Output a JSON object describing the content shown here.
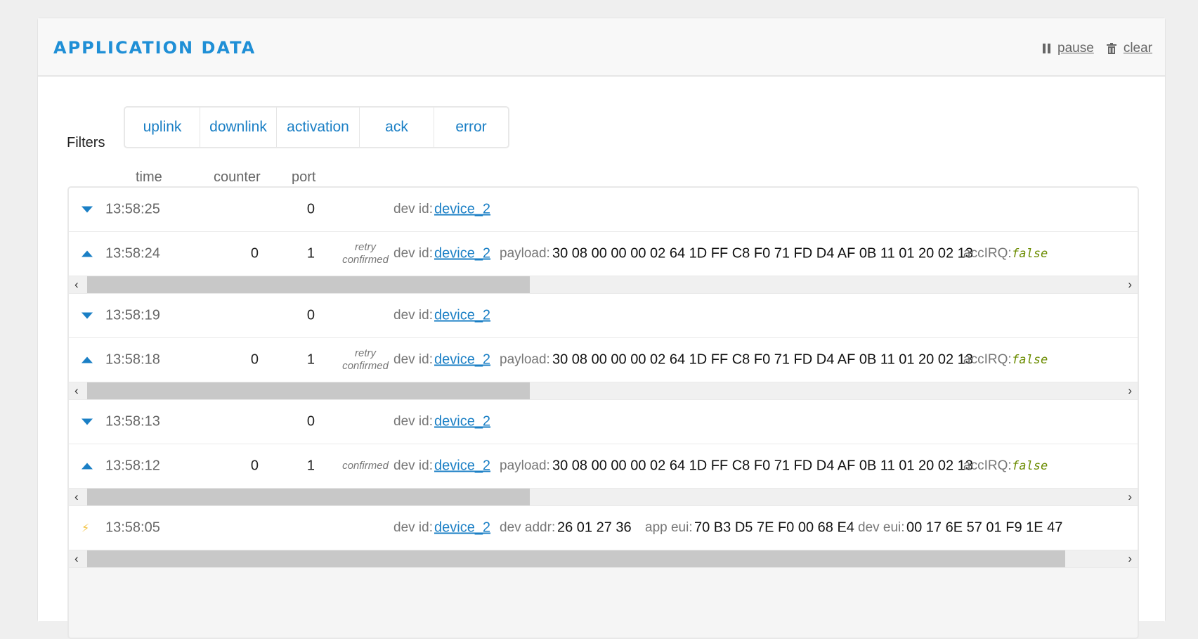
{
  "header": {
    "title": "APPLICATION DATA",
    "pause_label": "pause",
    "clear_label": "clear"
  },
  "filters": {
    "label": "Filters",
    "buttons": [
      "uplink",
      "downlink",
      "activation",
      "ack",
      "error"
    ]
  },
  "columns": {
    "time": "time",
    "counter": "counter",
    "port": "port"
  },
  "labels": {
    "dev_id": "dev id:",
    "payload": "payload:",
    "acc_irq": "accIRQ:",
    "dev_addr": "dev addr:",
    "app_eui": "app eui:",
    "dev_eui": "dev eui:"
  },
  "scroll": {
    "left_arrow": "‹",
    "right_arrow": "›"
  },
  "rows": [
    {
      "type": "downlink",
      "time": "13:58:25",
      "counter": "",
      "port": "0",
      "flag1": "",
      "flag2": "",
      "dev_id": "device_2"
    },
    {
      "type": "uplink",
      "time": "13:58:24",
      "counter": "0",
      "port": "1",
      "flag1": "retry",
      "flag2": "confirmed",
      "dev_id": "device_2",
      "payload": "30 08 00 00 00 02 64 1D FF C8 F0 71 FD D4 AF 0B 11 01 20 02 13",
      "acc_irq": "false",
      "scroll_fraction": 0.43
    },
    {
      "type": "downlink",
      "time": "13:58:19",
      "counter": "",
      "port": "0",
      "flag1": "",
      "flag2": "",
      "dev_id": "device_2"
    },
    {
      "type": "uplink",
      "time": "13:58:18",
      "counter": "0",
      "port": "1",
      "flag1": "retry",
      "flag2": "confirmed",
      "dev_id": "device_2",
      "payload": "30 08 00 00 00 02 64 1D FF C8 F0 71 FD D4 AF 0B 11 01 20 02 13",
      "acc_irq": "false",
      "scroll_fraction": 0.43
    },
    {
      "type": "downlink",
      "time": "13:58:13",
      "counter": "",
      "port": "0",
      "flag1": "",
      "flag2": "",
      "dev_id": "device_2"
    },
    {
      "type": "uplink",
      "time": "13:58:12",
      "counter": "0",
      "port": "1",
      "flag1": "confirmed",
      "flag2": "",
      "dev_id": "device_2",
      "payload": "30 08 00 00 00 02 64 1D FF C8 F0 71 FD D4 AF 0B 11 01 20 02 13",
      "acc_irq": "false",
      "scroll_fraction": 0.43
    },
    {
      "type": "activation",
      "time": "13:58:05",
      "counter": "",
      "port": "",
      "flag1": "",
      "flag2": "",
      "dev_id": "device_2",
      "dev_addr": "26 01 27 36",
      "app_eui": "70 B3 D5 7E F0 00 68 E4",
      "dev_eui": "00 17 6E 57 01 F9 1E 47",
      "scroll_fraction": 0.95
    }
  ]
}
